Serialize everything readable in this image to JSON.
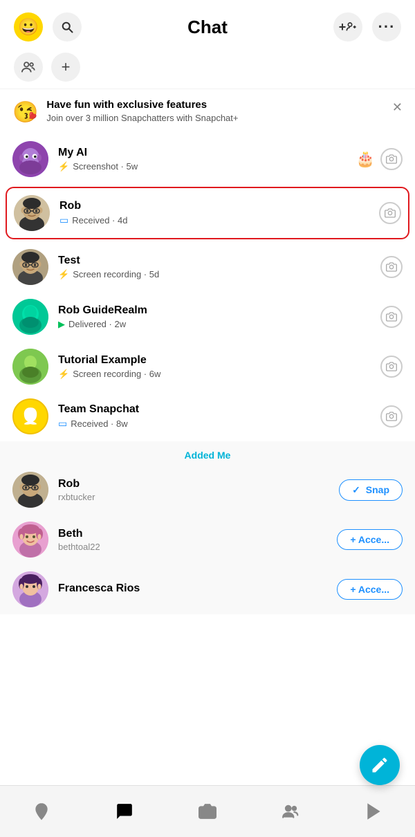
{
  "header": {
    "title": "Chat",
    "add_friend_icon": "➕👤",
    "more_icon": "•••"
  },
  "subheader": {
    "groups_icon": "👥",
    "new_chat_icon": "+"
  },
  "promo": {
    "emoji": "😘",
    "title": "Have fun with exclusive features",
    "subtitle": "Join over 3 million Snapchatters with Snapchat+"
  },
  "chats": [
    {
      "id": "myai",
      "name": "My AI",
      "status_icon": "⚡",
      "status_text": "Screenshot · 5w",
      "has_birthday": true,
      "highlighted": false,
      "avatar_emoji": "🤖"
    },
    {
      "id": "rob",
      "name": "Rob",
      "status_icon": "□",
      "status_text": "Received · 4d",
      "highlighted": true,
      "avatar_emoji": "🧑"
    },
    {
      "id": "test",
      "name": "Test",
      "status_icon": "⚡",
      "status_text": "Screen recording · 5d",
      "highlighted": false,
      "avatar_emoji": "🧔"
    },
    {
      "id": "robguide",
      "name": "Rob GuideRealm",
      "status_icon": "▶",
      "status_text": "Delivered · 2w",
      "status_color": "green",
      "highlighted": false,
      "avatar_emoji": "👤"
    },
    {
      "id": "tutorial",
      "name": "Tutorial Example",
      "status_icon": "⚡",
      "status_text": "Screen recording · 6w",
      "highlighted": false,
      "avatar_emoji": "👤"
    },
    {
      "id": "team",
      "name": "Team Snapchat",
      "status_icon": "□",
      "status_text": "Received · 8w",
      "highlighted": false,
      "avatar_emoji": "👻"
    }
  ],
  "section_label": "Added Me",
  "added_me": [
    {
      "id": "rob2",
      "name": "Rob",
      "username": "rxbtucker",
      "action": "✓ Snap"
    },
    {
      "id": "beth",
      "name": "Beth",
      "username": "bethtoal22",
      "action": "+ Acce..."
    },
    {
      "id": "francesca",
      "name": "Francesca Rios",
      "username": "",
      "action": "+ Acce..."
    }
  ],
  "nav": {
    "items": [
      "map",
      "chat",
      "camera",
      "friends",
      "stories"
    ]
  },
  "fab_label": "compose"
}
